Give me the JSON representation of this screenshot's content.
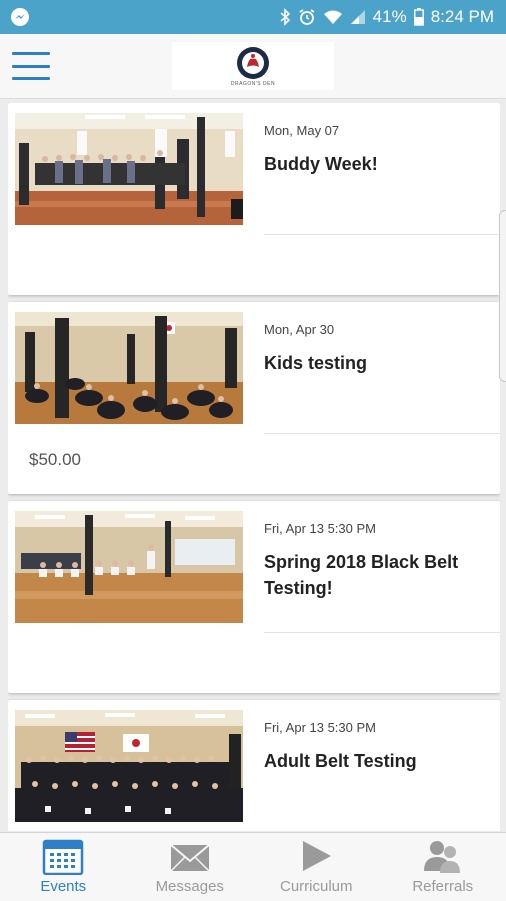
{
  "status_bar": {
    "battery": "41%",
    "time": "8:24 PM",
    "icons": [
      "messenger-icon",
      "bluetooth-icon",
      "alarm-icon",
      "wifi-icon",
      "signal-icon",
      "battery-icon"
    ]
  },
  "header": {
    "logo_text": "DRAGON'S DEN",
    "icons": [
      "hamburger-menu-icon"
    ]
  },
  "events": [
    {
      "date": "Mon, May 07",
      "title": "Buddy Week!",
      "price": ""
    },
    {
      "date": "Mon, Apr 30",
      "title": "Kids testing",
      "price": "$50.00"
    },
    {
      "date": "Fri, Apr 13 5:30 PM",
      "title": "Spring 2018 Black Belt Testing!",
      "price": ""
    },
    {
      "date": "Fri, Apr 13 5:30 PM",
      "title": "Adult Belt Testing",
      "price": ""
    }
  ],
  "nav": {
    "items": [
      {
        "label": "Events",
        "icon": "calendar-icon",
        "active": true
      },
      {
        "label": "Messages",
        "icon": "envelope-icon",
        "active": false
      },
      {
        "label": "Curriculum",
        "icon": "play-icon",
        "active": false
      },
      {
        "label": "Referrals",
        "icon": "people-icon",
        "active": false
      }
    ]
  },
  "colors": {
    "status_bar": "#4ba3c9",
    "accent": "#2d7fc7",
    "inactive": "#9a9a9a"
  }
}
